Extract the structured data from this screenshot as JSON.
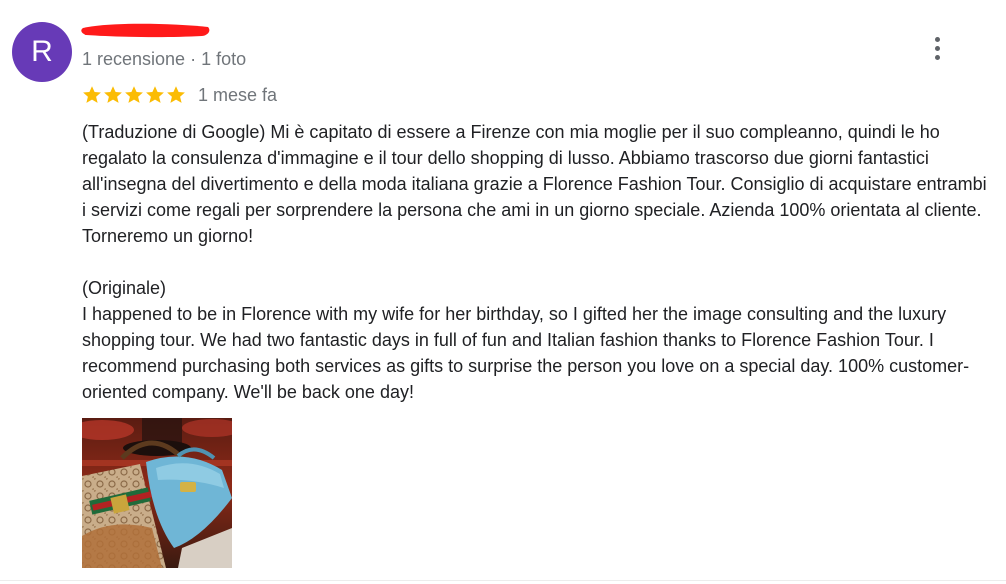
{
  "reviewer": {
    "avatar_letter": "R",
    "avatar_color": "#673ab7",
    "redaction_color": "#ff1a1a",
    "meta": "1 recensione · 1 foto"
  },
  "menu": {
    "icon": "more-vertical-icon"
  },
  "rating": {
    "stars": 5,
    "max": 5,
    "star_color": "#fbbc04",
    "time": "1 mese fa"
  },
  "review": {
    "translated": "(Traduzione di Google) Mi è capitato di essere a Firenze con mia moglie per il suo compleanno, quindi le ho regalato la consulenza d'immagine e il tour dello shopping di lusso. Abbiamo trascorso due giorni fantastici all'insegna del divertimento e della moda italiana grazie a Florence Fashion Tour. Consiglio di acquistare entrambi i servizi come regali per sorprendere la persona che ami in un giorno speciale. Azienda 100% orientata al cliente. Torneremo un giorno!",
    "original_label": "(Originale)",
    "original": "I happened to be in Florence with my wife for her birthday, so I gifted her the image consulting and the luxury shopping tour. We had two fantastic days in full of fun and Italian fashion thanks to Florence Fashion Tour. I recommend purchasing both services as gifts to surprise the person you love on a special day. 100% customer-oriented company. We'll be back one day!"
  },
  "photos": [
    {
      "subject": "designer-handbags-photo"
    }
  ]
}
